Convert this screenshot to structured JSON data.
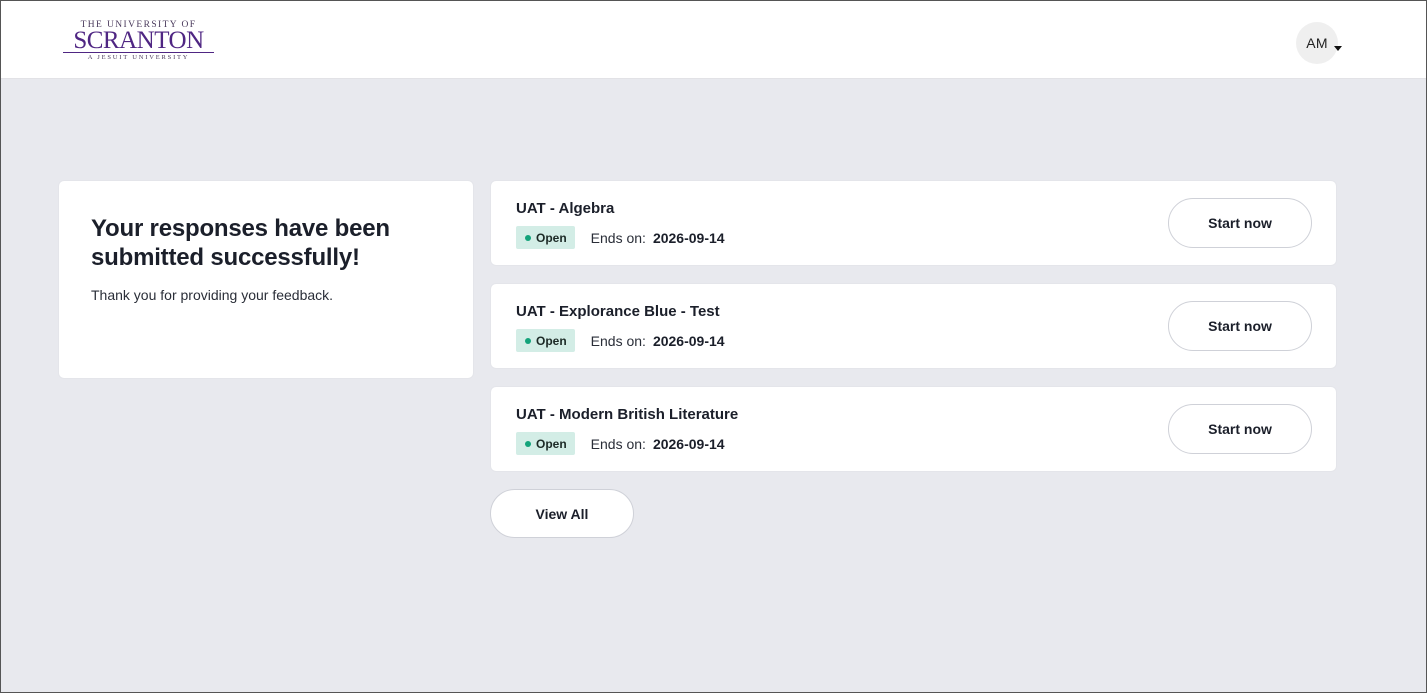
{
  "header": {
    "logo": {
      "line1": "THE UNIVERSITY OF",
      "line2": "SCRANTON",
      "line3": "A JESUIT UNIVERSITY"
    },
    "user_initials": "AM"
  },
  "success": {
    "title": "Your responses have been submitted successfully!",
    "message": "Thank you for providing your feedback."
  },
  "surveys": [
    {
      "title": "UAT - Algebra",
      "status": "Open",
      "ends_label": "Ends on:",
      "ends_date": "2026-09-14",
      "button": "Start now"
    },
    {
      "title": "UAT - Explorance Blue - Test",
      "status": "Open",
      "ends_label": "Ends on:",
      "ends_date": "2026-09-14",
      "button": "Start now"
    },
    {
      "title": "UAT - Modern British Literature",
      "status": "Open",
      "ends_label": "Ends on:",
      "ends_date": "2026-09-14",
      "button": "Start now"
    }
  ],
  "view_all_label": "View All",
  "colors": {
    "brand_purple": "#4f2683",
    "open_badge_bg": "#d3ede6",
    "open_dot": "#13a37a",
    "page_bg": "#e8e9ee"
  }
}
